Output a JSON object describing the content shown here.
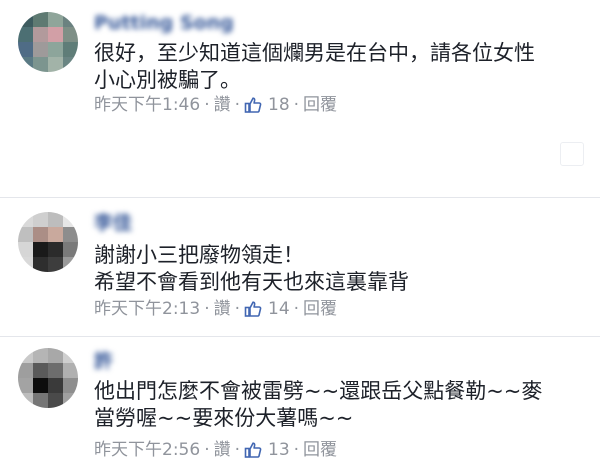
{
  "comments": [
    {
      "author": "Putting Song",
      "text_lines": [
        "很好，至少知道這個爛男是在台中，請各位女性",
        "小心別被騙了。"
      ],
      "time": "昨天下午1:46",
      "read_label": "讚",
      "likes": "18",
      "reply_label": "回覆",
      "dot": "·"
    },
    {
      "author": "李佳",
      "text_lines": [
        "謝謝小三把廢物領走！",
        "希望不會看到他有天也來這裏靠背"
      ],
      "time": "昨天下午2:13",
      "read_label": "讚",
      "likes": "14",
      "reply_label": "回覆",
      "dot": "·"
    },
    {
      "author": "許",
      "text_lines": [
        "他出門怎麼不會被雷劈~~還跟岳父點餐勒~~麥",
        "當勞喔~~要來份大薯嗎~~"
      ],
      "time": "昨天下午2:56",
      "read_label": "讚",
      "likes": "13",
      "reply_label": "回覆",
      "dot": "·"
    }
  ],
  "icons": {
    "like": "thumbs-up-icon"
  },
  "colors": {
    "link": "#365899",
    "meta": "#90949c",
    "like_icon": "#4267b2",
    "text": "#1d2129"
  }
}
